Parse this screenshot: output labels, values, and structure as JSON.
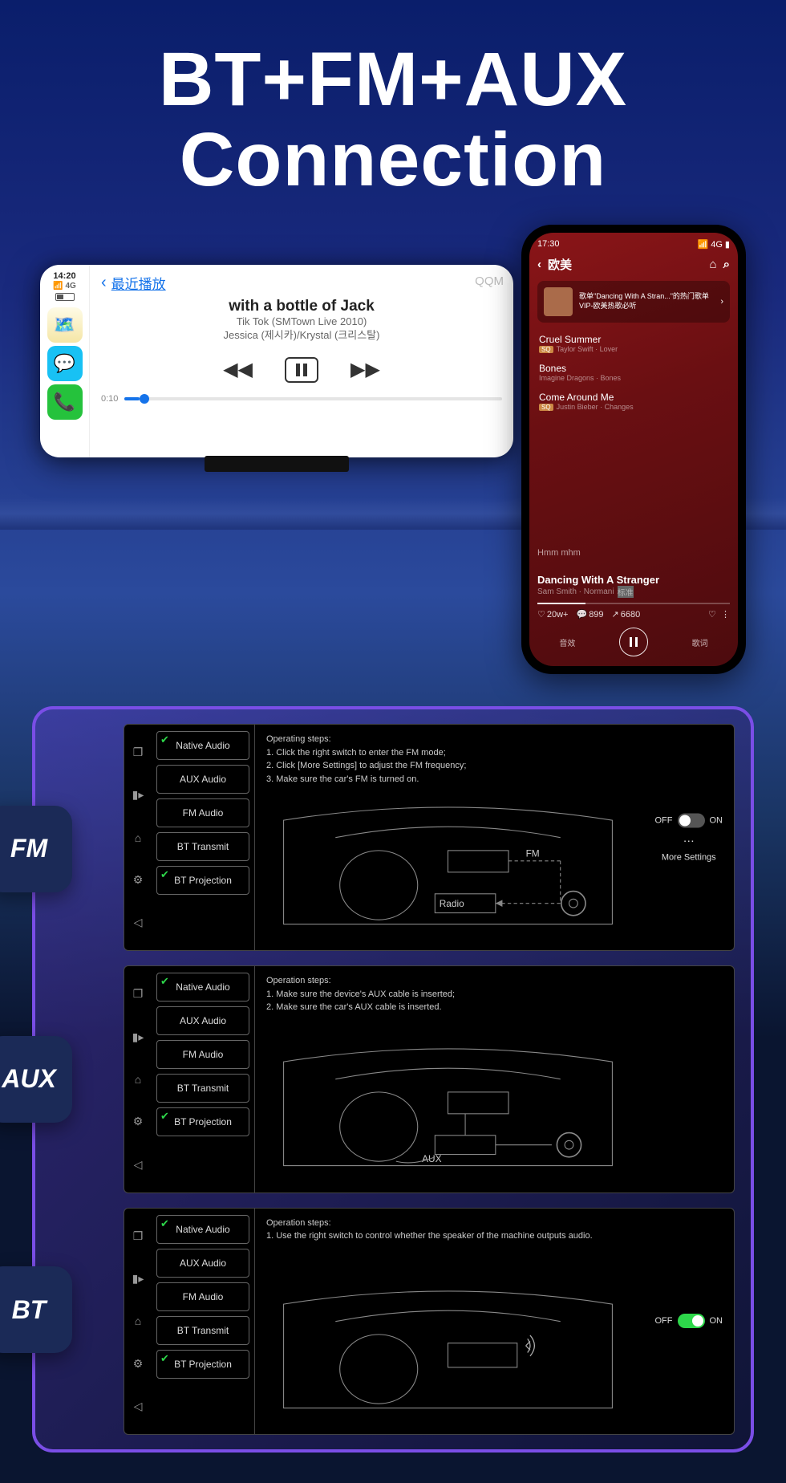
{
  "hero": {
    "line1": "BT+FM+AUX",
    "line2": "Connection"
  },
  "device": {
    "time": "14:20",
    "signal": "4G",
    "back_label": "最近播放",
    "source": "QQM",
    "song_title": "with a bottle of Jack",
    "song_sub1": "Tik Tok (SMTown Live 2010)",
    "song_sub2": "Jessica (제시카)/Krystal (크리스탈)",
    "elapsed": "0:10"
  },
  "phone": {
    "time": "17:30",
    "title": "欧美",
    "card_line1": "歌单\"Dancing With A Stran...\"的热门歌单",
    "card_line2": "VIP-欧美热歌必听",
    "tracks": [
      {
        "name": "Cruel Summer",
        "artist": "Taylor Swift · Lover",
        "badge": "SQ"
      },
      {
        "name": "Bones",
        "artist": "Imagine Dragons · Bones",
        "badge": ""
      },
      {
        "name": "Come Around Me",
        "artist": "Justin Bieber · Changes",
        "badge": "SQ"
      }
    ],
    "section": "Hmm mhm",
    "now_title": "Dancing With A Stranger",
    "now_artist": "Sam Smith · Normani",
    "now_badge": "标准",
    "like_main": "20w+",
    "stat_comment": "899",
    "stat_share": "6680",
    "bottom_left": "音效",
    "bottom_right": "歌词"
  },
  "modes": {
    "fm": {
      "badge": "FM"
    },
    "aux": {
      "badge": "AUX"
    },
    "bt": {
      "badge": "BT"
    }
  },
  "menu_items": [
    "Native Audio",
    "AUX Audio",
    "FM Audio",
    "BT Transmit",
    "BT Projection"
  ],
  "panels": {
    "fm": {
      "steps_title": "Operating steps:",
      "steps": "1. Click the right switch to enter the FM mode;\n2. Click [More Settings] to adjust the FM frequency;\n3. Make sure the car's FM is turned on.",
      "toggle_off": "OFF",
      "toggle_on": "ON",
      "more": "More Settings",
      "label_fm": "FM",
      "label_radio": "Radio"
    },
    "aux": {
      "steps_title": "Operation steps:",
      "steps": "1. Make sure the device's AUX cable is inserted;\n2. Make sure the car's AUX cable is inserted.",
      "label_aux": "AUX"
    },
    "bt": {
      "steps_title": "Operation steps:",
      "steps": "1. Use the right switch to control whether the speaker of the machine outputs audio.",
      "toggle_off": "OFF",
      "toggle_on": "ON"
    }
  }
}
